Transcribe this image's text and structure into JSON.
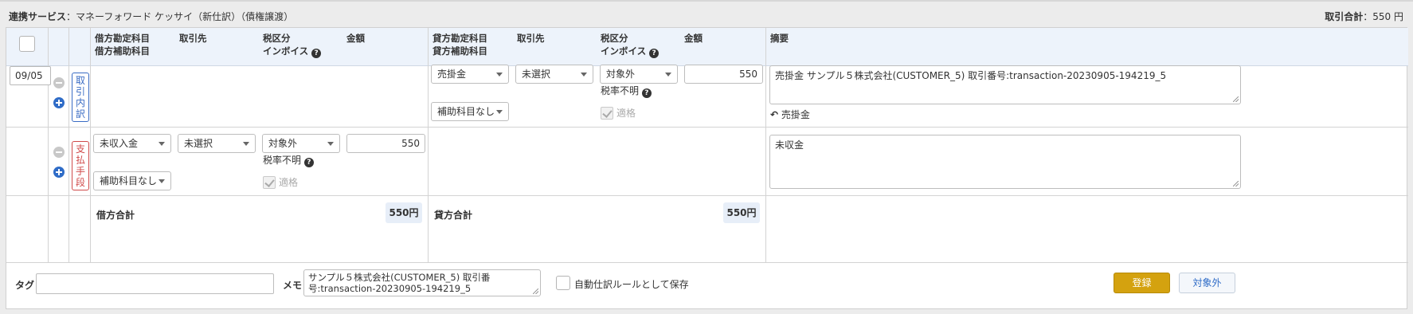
{
  "header": {
    "service_label": "連携サービス",
    "service_value": "：マネーフォワード ケッサイ（新仕訳）（債権譲渡）",
    "total_label": "取引合計",
    "total_value": "：550 円"
  },
  "columns": {
    "debit_account": "借方勘定科目",
    "debit_sub_account": "借方補助科目",
    "debit_partner": "取引先",
    "debit_tax": "税区分",
    "debit_invoice": "インボイス",
    "debit_amount": "金額",
    "credit_account": "貸方勘定科目",
    "credit_sub_account": "貸方補助科目",
    "credit_partner": "取引先",
    "credit_tax": "税区分",
    "credit_invoice": "インボイス",
    "credit_amount": "金額",
    "summary": "摘要"
  },
  "date": "09/05",
  "rows": [
    {
      "badge": "取引内訳",
      "credit": {
        "account": "売掛金",
        "partner": "未選択",
        "tax": "対象外",
        "amount": "550",
        "sub_account": "補助科目なし",
        "tax_rate_note": "税率不明",
        "qualified_label": "適格"
      },
      "summary": "売掛金 サンプル５株式会社(CUSTOMER_5) 取引番号:transaction-20230905-194219_5",
      "revert_label": "売掛金"
    },
    {
      "badge": "支払手段",
      "debit": {
        "account": "未収入金",
        "partner": "未選択",
        "tax": "対象外",
        "amount": "550",
        "sub_account": "補助科目なし",
        "tax_rate_note": "税率不明",
        "qualified_label": "適格"
      },
      "summary": "未収金"
    }
  ],
  "totals": {
    "debit_label": "借方合計",
    "debit_value": "550円",
    "credit_label": "貸方合計",
    "credit_value": "550円"
  },
  "footer": {
    "tag_label": "タグ",
    "tag_value": "",
    "memo_label": "メモ",
    "memo_value": "サンプル５株式会社(CUSTOMER_5) 取引番号:transaction-20230905-194219_5",
    "auto_rule_label": "自動仕訳ルールとして保存",
    "register_button": "登録",
    "exclude_button": "対象外"
  },
  "colors": {
    "header_bg": "#edf3fb",
    "primary_button": "#d4a20f",
    "link_blue": "#2f6cc7",
    "badge_red": "#d04a4a"
  }
}
